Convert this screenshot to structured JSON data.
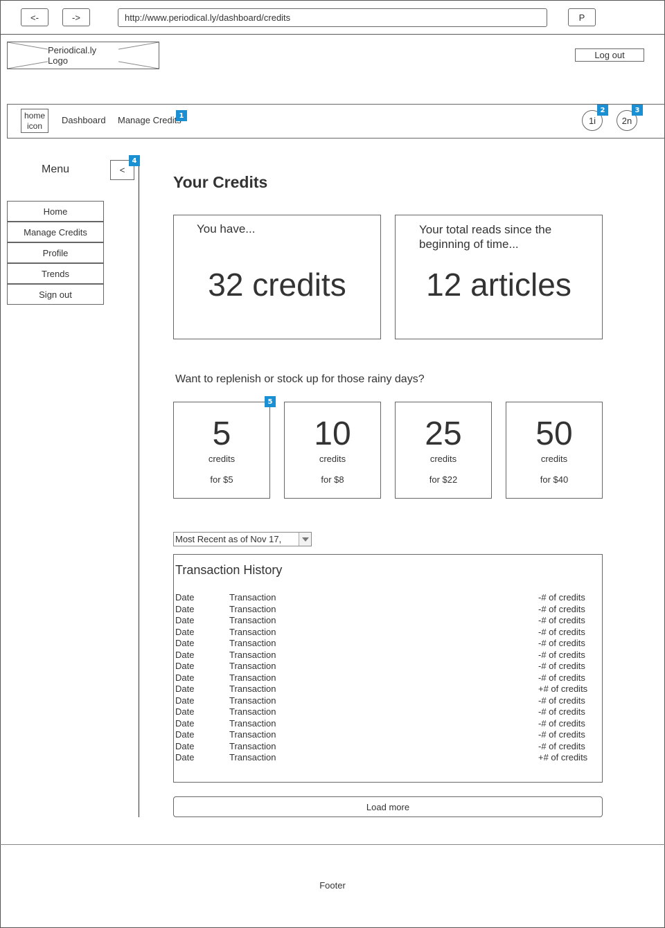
{
  "browser": {
    "back_label": "<-",
    "forward_label": "->",
    "url": "http://www.periodical.ly/dashboard/credits",
    "profile_label": "P"
  },
  "header": {
    "logo_text": "Periodical.ly Logo",
    "logout_label": "Log out"
  },
  "nav": {
    "home_icon_label": "home\nicon",
    "items": [
      "Dashboard",
      "Manage Credits"
    ],
    "notification_badges": [
      "1i",
      "2n"
    ]
  },
  "markers": [
    "1",
    "2",
    "3",
    "4",
    "5"
  ],
  "sidebar": {
    "title": "Menu",
    "collapse_label": "<",
    "items": [
      "Home",
      "Manage Credits",
      "Profile",
      "Trends",
      "Sign out"
    ]
  },
  "main": {
    "title": "Your Credits",
    "credits_card": {
      "caption": "You have...",
      "value": "32 credits"
    },
    "reads_card": {
      "caption": "Your total reads since the beginning of time...",
      "value": "12 articles"
    },
    "replenish_prompt": "Want to replenish or stock up for those rainy days?",
    "packages": [
      {
        "amount": "5",
        "unit": "credits",
        "price": "for $5"
      },
      {
        "amount": "10",
        "unit": "credits",
        "price": "for $8"
      },
      {
        "amount": "25",
        "unit": "credits",
        "price": "for $22"
      },
      {
        "amount": "50",
        "unit": "credits",
        "price": "for $40"
      }
    ],
    "filter": {
      "selected": "Most Recent as of Nov 17,"
    },
    "history": {
      "title": "Transaction History",
      "rows": [
        {
          "date": "Date",
          "transaction": "Transaction",
          "amount": "-# of credits"
        },
        {
          "date": "Date",
          "transaction": "Transaction",
          "amount": "-# of credits"
        },
        {
          "date": "Date",
          "transaction": "Transaction",
          "amount": "-# of credits"
        },
        {
          "date": "Date",
          "transaction": "Transaction",
          "amount": "-# of credits"
        },
        {
          "date": "Date",
          "transaction": "Transaction",
          "amount": "-# of credits"
        },
        {
          "date": "Date",
          "transaction": "Transaction",
          "amount": "-# of credits"
        },
        {
          "date": "Date",
          "transaction": "Transaction",
          "amount": "-# of credits"
        },
        {
          "date": "Date",
          "transaction": "Transaction",
          "amount": "-# of credits"
        },
        {
          "date": "Date",
          "transaction": "Transaction",
          "amount": "+# of credits"
        },
        {
          "date": "Date",
          "transaction": "Transaction",
          "amount": "-# of credits"
        },
        {
          "date": "Date",
          "transaction": "Transaction",
          "amount": "-# of credits"
        },
        {
          "date": "Date",
          "transaction": "Transaction",
          "amount": "-# of credits"
        },
        {
          "date": "Date",
          "transaction": "Transaction",
          "amount": "-# of credits"
        },
        {
          "date": "Date",
          "transaction": "Transaction",
          "amount": "-# of credits"
        },
        {
          "date": "Date",
          "transaction": "Transaction",
          "amount": "+# of credits"
        }
      ]
    },
    "load_more_label": "Load more"
  },
  "footer": {
    "text": "Footer"
  },
  "colors": {
    "marker": "#1a8fd1",
    "border": "#666666",
    "text": "#333333"
  }
}
